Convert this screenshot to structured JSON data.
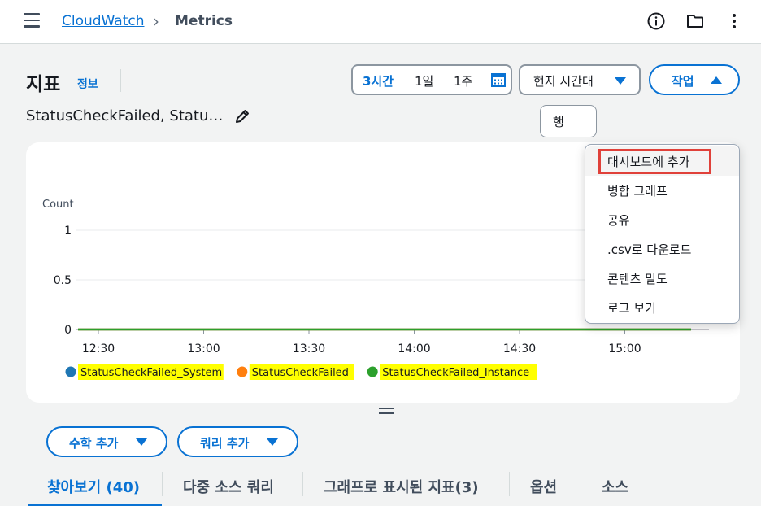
{
  "breadcrumb": {
    "root": "CloudWatch",
    "current": "Metrics"
  },
  "icons": {
    "menu": "hamburger-icon",
    "info": "info-icon",
    "folder": "folder-icon",
    "more": "more-vertical-icon",
    "edit": "pencil-icon",
    "calendar": "calendar-icon"
  },
  "header": {
    "title": "지표",
    "info_link": "정보",
    "subtitle": "StatusCheckFailed, Statu…"
  },
  "time_range": {
    "options": [
      "3시간",
      "1일",
      "1주"
    ],
    "selected": "3시간"
  },
  "timezone": {
    "label": "현지 시간대"
  },
  "actions": {
    "label": "작업"
  },
  "row_button": {
    "label": "행"
  },
  "dropdown": {
    "items": [
      "대시보드에 추가",
      "병합 그래프",
      "공유",
      ".csv로 다운로드",
      "콘텐츠 밀도",
      "로그 보기"
    ],
    "highlighted": "대시보드에 추가"
  },
  "chart_data": {
    "type": "line",
    "ylabel": "Count",
    "ylim": [
      0,
      1
    ],
    "yticks": [
      "1",
      "0.5",
      "0"
    ],
    "categories": [
      "12:30",
      "13:00",
      "13:30",
      "14:00",
      "14:30",
      "15:00"
    ],
    "series": [
      {
        "name": "StatusCheckFailed_System",
        "color": "#1f77b4",
        "values": [
          0,
          0,
          0,
          0,
          0,
          0
        ]
      },
      {
        "name": "StatusCheckFailed",
        "color": "#ff7f0e",
        "values": [
          0,
          0,
          0,
          0,
          0,
          0
        ]
      },
      {
        "name": "StatusCheckFailed_Instance",
        "color": "#2ca02c",
        "values": [
          0,
          0,
          0,
          0,
          0,
          0
        ]
      }
    ],
    "legend_highlight": "#ffff00",
    "grid": true,
    "legend_position": "bottom-left"
  },
  "buttons": {
    "add_math": "수학 추가",
    "add_query": "쿼리 추가"
  },
  "tabs": [
    "찾아보기 (40)",
    "다중 소스 쿼리",
    "그래프로 표시된 지표(3)",
    "옵션",
    "소스"
  ],
  "colors": {
    "accent": "#0972d3",
    "highlight_box": "#e0413a"
  }
}
